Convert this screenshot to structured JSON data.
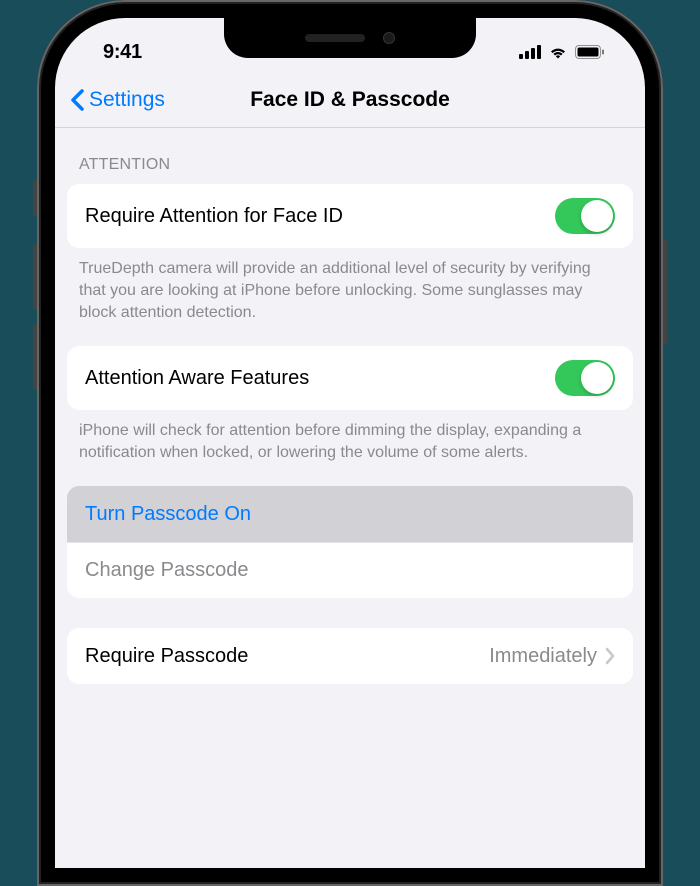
{
  "status_bar": {
    "time": "9:41"
  },
  "nav": {
    "back_label": "Settings",
    "title": "Face ID & Passcode"
  },
  "sections": {
    "attention": {
      "header": "ATTENTION",
      "require_attention": {
        "label": "Require Attention for Face ID",
        "enabled": true,
        "footer": "TrueDepth camera will provide an additional level of security by verifying that you are looking at iPhone before unlocking. Some sunglasses may block attention detection."
      },
      "aware_features": {
        "label": "Attention Aware Features",
        "enabled": true,
        "footer": "iPhone will check for attention before dimming the display, expanding a notification when locked, or lowering the volume of some alerts."
      }
    },
    "passcode": {
      "turn_on_label": "Turn Passcode On",
      "change_label": "Change Passcode"
    },
    "require": {
      "label": "Require Passcode",
      "value": "Immediately"
    }
  }
}
